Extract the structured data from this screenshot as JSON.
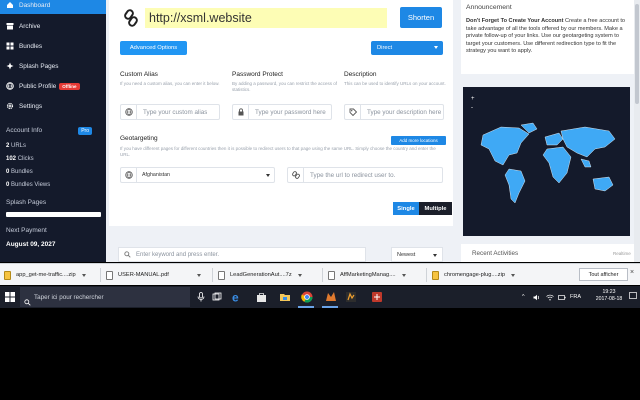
{
  "sidebar": {
    "items": [
      {
        "label": "Dashboard",
        "icon": "home-icon"
      },
      {
        "label": "Archive",
        "icon": "archive-icon"
      },
      {
        "label": "Bundles",
        "icon": "bundles-icon"
      },
      {
        "label": "Splash Pages",
        "icon": "splash-icon"
      },
      {
        "label": "Public Profile",
        "icon": "profile-icon",
        "badge": "Offline"
      },
      {
        "label": "Settings",
        "icon": "gear-icon"
      }
    ],
    "account_info": "Account Info",
    "account_badge": "Pro",
    "stats": [
      {
        "value": "2",
        "label": "URLs"
      },
      {
        "value": "102",
        "label": "Clicks"
      },
      {
        "value": "0",
        "label": "Bundles"
      },
      {
        "value": "0",
        "label": "Bundles Views"
      }
    ],
    "splash_pages": "Splash Pages",
    "next_payment": "Next Payment",
    "next_payment_date": "August 09, 2027"
  },
  "shortener": {
    "url_value": "http://xsml.website",
    "shorten_label": "Shorten",
    "advanced_label": "Advanced Options",
    "redirect_label": "Direct"
  },
  "fields": {
    "alias": {
      "title": "Custom Alias",
      "desc": "If you need a custom alias, you can enter it below.",
      "placeholder": "Type your custom alias"
    },
    "password": {
      "title": "Password Protect",
      "desc": "By adding a password, you can restrict the access of statistics.",
      "placeholder": "Type your password here"
    },
    "description": {
      "title": "Description",
      "desc": "This can be used to identify URLs on your account.",
      "placeholder": "Type your description here"
    }
  },
  "geo": {
    "title": "Geotargeting",
    "desc": "If you have different pages for different countries then it is possible to redirect users to that page using the same URL. Simply choose the country and enter the URL.",
    "add_label": "Add more locations",
    "country": "Afghanistan",
    "url_placeholder": "Type the url to redirect user to."
  },
  "mode": {
    "single": "Single",
    "multiple": "Multiple"
  },
  "list": {
    "search_placeholder": "Enter keyword and press enter.",
    "sort": "Newest"
  },
  "announcement": {
    "header": "Announcement",
    "title": "Don't Forget To Create Your Account",
    "body": " Create a free account to take advantage of all the tools offered by our members. Make a private follow-up of your links. Use our geotargeting system to target your customers. Use different redirection type to fit the strategy you want to apply."
  },
  "map": {
    "zoom_in": "+",
    "zoom_out": "-"
  },
  "recent": {
    "title": "Recent Activities",
    "realtime": "Realtime"
  },
  "downloads": {
    "items": [
      "app_get-me-traffic....zip",
      "USER-MANUAL.pdf",
      "LeadGenerationAut....7z",
      "AffMarketingManag....",
      "chromengage-plug....zip"
    ],
    "show_all": "Tout afficher",
    "close": "×"
  },
  "taskbar": {
    "search_placeholder": "Taper ici pour rechercher",
    "lang": "FRA",
    "time": "19:23",
    "date": "2017-08-18"
  },
  "colors": {
    "accent": "#1e88e5",
    "sidebar_bg": "#141a2b",
    "map_land": "#3fa9f5"
  }
}
